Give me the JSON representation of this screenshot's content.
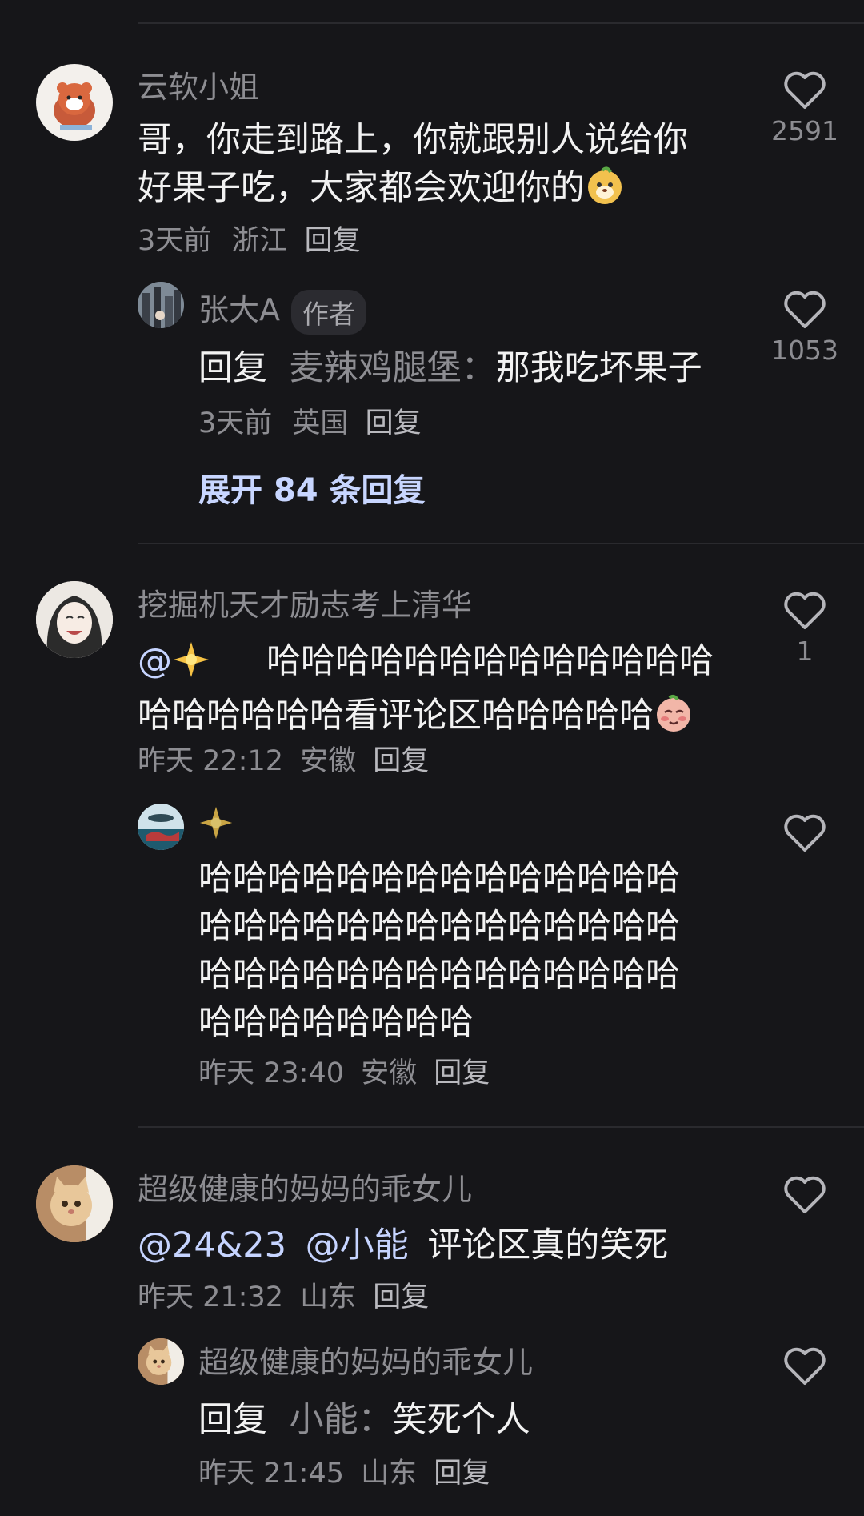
{
  "comments": [
    {
      "username": "云软小姐",
      "text_line1": "哥，你走到路上，你就跟别人说给你",
      "text_line2": "好果子吃，大家都会欢迎你的",
      "time": "3天前",
      "location": "浙江",
      "reply_label": "回复",
      "likes": "2591",
      "reply": {
        "username": "张大A",
        "author_tag": "作者",
        "reply_prefix": "回复",
        "reply_to": "麦辣鸡腿堡",
        "text": "那我吃坏果子",
        "time": "3天前",
        "location": "英国",
        "reply_label": "回复",
        "likes": "1053"
      },
      "expand_label": "展开 84 条回复"
    },
    {
      "username": "挖掘机天才励志考上清华",
      "mention": "@",
      "text_line1": "哈哈哈哈哈哈哈哈哈哈哈哈哈",
      "text_line2": "哈哈哈哈哈哈看评论区哈哈哈哈哈",
      "time": "昨天 22:12",
      "location": "安徽",
      "reply_label": "回复",
      "likes": "1",
      "reply": {
        "lines": [
          "哈哈哈哈哈哈哈哈哈哈哈哈哈哈",
          "哈哈哈哈哈哈哈哈哈哈哈哈哈哈",
          "哈哈哈哈哈哈哈哈哈哈哈哈哈哈",
          "哈哈哈哈哈哈哈哈"
        ],
        "time": "昨天 23:40",
        "location": "安徽",
        "reply_label": "回复"
      }
    },
    {
      "username": "超级健康的妈妈的乖女儿",
      "mention1": "@24&23",
      "mention2": "@小能",
      "text": "评论区真的笑死",
      "time": "昨天 21:32",
      "location": "山东",
      "reply_label": "回复",
      "reply": {
        "username": "超级健康的妈妈的乖女儿",
        "reply_prefix": "回复",
        "reply_to": "小能",
        "text": "笑死个人",
        "time": "昨天 21:45",
        "location": "山东",
        "reply_label": "回复"
      }
    }
  ],
  "colors": {
    "background": "#161619",
    "secondary_text": "#8d8d92",
    "mention": "#c6d4ff"
  }
}
